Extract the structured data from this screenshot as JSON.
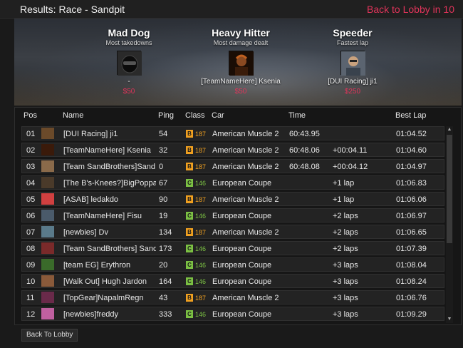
{
  "title": "Results: Race - Sandpit",
  "lobby_timer": "Back to Lobby in 10",
  "colors": {
    "accent": "#e0345a",
    "class_b": "#f0a020",
    "class_c": "#7bc043"
  },
  "awards": [
    {
      "name": "Mad Dog",
      "desc": "Most takedowns",
      "player": "-",
      "prize": "$50",
      "avatar_icon": "helmet-icon"
    },
    {
      "name": "Heavy Hitter",
      "desc": "Most damage dealt",
      "player": "[TeamNameHere] Ksenia",
      "prize": "$50",
      "avatar_icon": "player-portrait"
    },
    {
      "name": "Speeder",
      "desc": "Fastest lap",
      "player": "[DUI Racing] ji1",
      "prize": "$250",
      "avatar_icon": "player-portrait"
    }
  ],
  "columns": {
    "pos": "Pos",
    "name": "Name",
    "ping": "Ping",
    "class": "Class",
    "car": "Car",
    "time": "Time",
    "best": "Best Lap"
  },
  "rows": [
    {
      "pos": "01",
      "name": "[DUI Racing] ji1",
      "ping": "54",
      "badge": "B",
      "cls": "187",
      "car": "American Muscle 2",
      "time": "60:43.95",
      "gap": "",
      "best": "01:04.52"
    },
    {
      "pos": "02",
      "name": "[TeamNameHere] Ksenia",
      "ping": "32",
      "badge": "B",
      "cls": "187",
      "car": "American Muscle 2",
      "time": "60:48.06",
      "gap": "+00:04.11",
      "best": "01:04.60"
    },
    {
      "pos": "03",
      "name": "[Team SandBrothers]Sand...",
      "ping": "0",
      "badge": "B",
      "cls": "187",
      "car": "American Muscle 2",
      "time": "60:48.08",
      "gap": "+00:04.12",
      "best": "01:04.97"
    },
    {
      "pos": "04",
      "name": "[The B's-Knees?]BigPoppa_C",
      "ping": "67",
      "badge": "C",
      "cls": "146",
      "car": "European Coupe",
      "time": "",
      "gap": "+1 lap",
      "best": "01:06.83"
    },
    {
      "pos": "05",
      "name": "[ASAB] ledakdo",
      "ping": "90",
      "badge": "B",
      "cls": "187",
      "car": "American Muscle 2",
      "time": "",
      "gap": "+1 lap",
      "best": "01:06.06"
    },
    {
      "pos": "06",
      "name": "[TeamNameHere] Fisu",
      "ping": "19",
      "badge": "C",
      "cls": "146",
      "car": "European Coupe",
      "time": "",
      "gap": "+2 laps",
      "best": "01:06.97"
    },
    {
      "pos": "07",
      "name": "[newbies] Dv",
      "ping": "134",
      "badge": "B",
      "cls": "187",
      "car": "American Muscle 2",
      "time": "",
      "gap": "+2 laps",
      "best": "01:06.65"
    },
    {
      "pos": "08",
      "name": "[Team SandBrothers] Sand...",
      "ping": "173",
      "badge": "C",
      "cls": "146",
      "car": "European Coupe",
      "time": "",
      "gap": "+2 laps",
      "best": "01:07.39"
    },
    {
      "pos": "09",
      "name": "[team EG] Erythron",
      "ping": "20",
      "badge": "C",
      "cls": "146",
      "car": "European Coupe",
      "time": "",
      "gap": "+3 laps",
      "best": "01:08.04"
    },
    {
      "pos": "10",
      "name": "[Walk Out] Hugh Jardon",
      "ping": "164",
      "badge": "C",
      "cls": "146",
      "car": "European Coupe",
      "time": "",
      "gap": "+3 laps",
      "best": "01:08.24"
    },
    {
      "pos": "11",
      "name": "[TopGear]NapalmRegn",
      "ping": "43",
      "badge": "B",
      "cls": "187",
      "car": "American Muscle 2",
      "time": "",
      "gap": "+3 laps",
      "best": "01:06.76"
    },
    {
      "pos": "12",
      "name": "[newbies]freddy",
      "ping": "333",
      "badge": "C",
      "cls": "146",
      "car": "European Coupe",
      "time": "",
      "gap": "+3 laps",
      "best": "01:09.29"
    }
  ],
  "back_button": "Back To Lobby"
}
